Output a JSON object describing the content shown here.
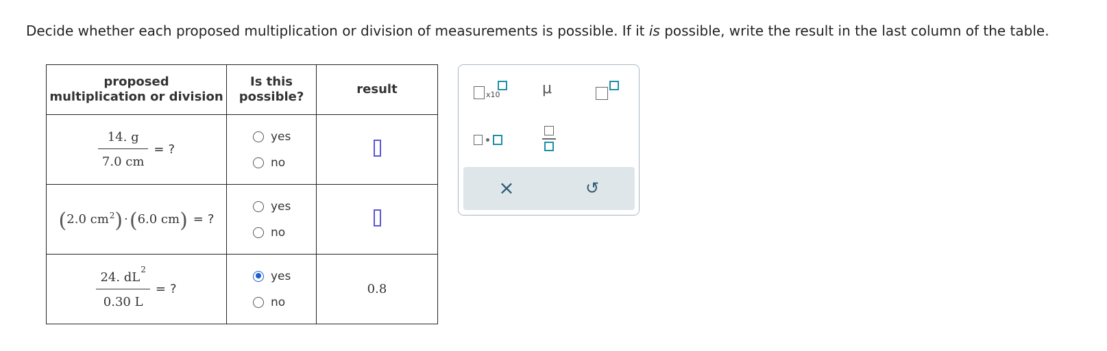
{
  "instructions": {
    "part1": "Decide whether each proposed multiplication or division of measurements is possible. If it ",
    "emph": "is",
    "part2": " possible, write the result in the last column of the table."
  },
  "table": {
    "headers": {
      "col1_line1": "proposed",
      "col1_line2": "multiplication or division",
      "col2_line1": "Is this",
      "col2_line2": "possible?",
      "col3": "result"
    },
    "rows": [
      {
        "num": "14. g",
        "den": "7.0 cm",
        "equals": "=",
        "question": "?",
        "yes_label": "yes",
        "no_label": "no",
        "selected": "none",
        "result": ""
      },
      {
        "left_value": "2.0 cm",
        "left_exp": "2",
        "dot": "·",
        "right_value": "6.0 cm",
        "equals": "=",
        "question": "?",
        "yes_label": "yes",
        "no_label": "no",
        "selected": "none",
        "result": ""
      },
      {
        "num": "24. dL",
        "num_exp": "2",
        "den": "0.30 L",
        "equals": "=",
        "question": "?",
        "yes_label": "yes",
        "no_label": "no",
        "selected": "yes",
        "result": "0.8"
      }
    ]
  },
  "palette": {
    "x10_label": "x10",
    "mu_symbol": "μ",
    "clear_icon": "×",
    "undo_icon": "↺",
    "accent_color": "#1b8ea8",
    "footer_color": "#dfe6ea"
  }
}
